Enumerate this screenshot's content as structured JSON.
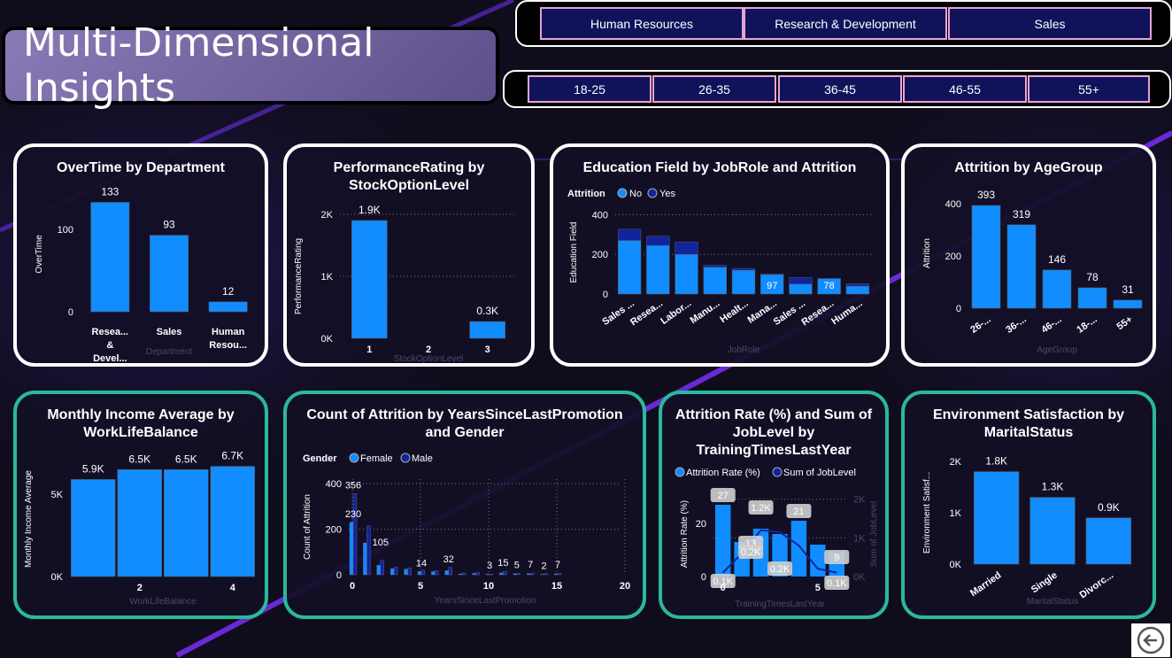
{
  "page": {
    "title": "Multi-Dimensional Insights"
  },
  "colors": {
    "bar": "#118dff",
    "dark_bar": "#12239e",
    "accent": "#2ab99a"
  },
  "slicers": {
    "department": [
      "Human Resources",
      "Research & Development",
      "Sales"
    ],
    "age_group": [
      "18-25",
      "26-35",
      "36-45",
      "46-55",
      "55+"
    ]
  },
  "icons": {
    "back": "back-arrow-icon"
  },
  "charts": {
    "overtime": {
      "title": "OverTime by Department"
    },
    "performance": {
      "title": "PerformanceRating by StockOptionLevel"
    },
    "education": {
      "title": "Education Field by JobRole and Attrition"
    },
    "agegroup": {
      "title": "Attrition by AgeGroup"
    },
    "income": {
      "title": "Monthly Income Average by WorkLifeBalance"
    },
    "promotion": {
      "title": "Count of Attrition by YearsSinceLastPromotion and Gender"
    },
    "training": {
      "title": "Attrition Rate (%) and Sum of JobLevel by TrainingTimesLastYear"
    },
    "environment": {
      "title": "Environment Satisfaction by MaritalStatus"
    }
  },
  "chart_data": [
    {
      "id": "overtime",
      "type": "bar",
      "title": "OverTime by Department",
      "ylabel": "OverTime",
      "xlabel": "Department",
      "categories": [
        "Resea... & Devel...",
        "Sales",
        "Human Resou..."
      ],
      "values": [
        133,
        93,
        12
      ],
      "data_labels": [
        "133",
        "93",
        "12"
      ],
      "yticks": [
        "0",
        "100"
      ],
      "ylim": [
        0,
        140
      ]
    },
    {
      "id": "performance",
      "type": "bar",
      "title": "PerformanceRating by StockOptionLevel",
      "ylabel": "PerformanceRating",
      "xlabel": "StockOptionLevel",
      "categories": [
        "1",
        "2",
        "3"
      ],
      "values": [
        1900,
        0,
        270
      ],
      "data_labels": [
        "1.9K",
        "",
        "0.3K"
      ],
      "yticks": [
        "0K",
        "1K",
        "2K"
      ],
      "ylim": [
        0,
        2000
      ]
    },
    {
      "id": "education",
      "type": "bar",
      "title": "Education Field by JobRole and Attrition",
      "ylabel": "Education Field",
      "xlabel": "JobRole",
      "legend_title": "Attrition",
      "categories": [
        "Sales ...",
        "Resea...",
        "Labor...",
        "Manu...",
        "Healt...",
        "Mana...",
        "Sales ...",
        "Resea...",
        "Huma..."
      ],
      "series": [
        {
          "name": "No",
          "values": [
            270,
            245,
            200,
            135,
            120,
            97,
            50,
            78,
            40
          ]
        },
        {
          "name": "Yes",
          "values": [
            57,
            47,
            62,
            10,
            9,
            5,
            33,
            0,
            12
          ]
        }
      ],
      "data_labels": {
        "5": "97",
        "7": "78"
      },
      "yticks": [
        "0",
        "200",
        "400"
      ],
      "ylim": [
        0,
        420
      ]
    },
    {
      "id": "agegroup",
      "type": "bar",
      "title": "Attrition by AgeGroup",
      "ylabel": "Attrition",
      "xlabel": "AgeGroup",
      "categories": [
        "26-...",
        "36-...",
        "46-...",
        "18-...",
        "55+"
      ],
      "values": [
        393,
        319,
        146,
        78,
        31
      ],
      "data_labels": [
        "393",
        "319",
        "146",
        "78",
        "31"
      ],
      "yticks": [
        "0",
        "200",
        "400"
      ],
      "ylim": [
        0,
        420
      ]
    },
    {
      "id": "income",
      "type": "bar",
      "title": "Monthly Income Average by WorkLifeBalance",
      "ylabel": "Monthly Income Average",
      "xlabel": "WorkLifeBalance",
      "categories": [
        "1",
        "2",
        "3",
        "4"
      ],
      "tick_labels": [
        "",
        "2",
        "",
        "4"
      ],
      "values": [
        5900,
        6500,
        6500,
        6700
      ],
      "data_labels": [
        "5.9K",
        "6.5K",
        "6.5K",
        "6.7K"
      ],
      "yticks": [
        "0K",
        "5K"
      ],
      "ylim": [
        0,
        7000
      ]
    },
    {
      "id": "promotion",
      "type": "bar",
      "title": "Count of Attrition by YearsSinceLastPromotion and Gender",
      "ylabel": "Count of Attrition",
      "xlabel": "YearsSinceLastPromotion",
      "legend_title": "Gender",
      "x": [
        0,
        1,
        2,
        3,
        4,
        5,
        6,
        7,
        8,
        9,
        10,
        11,
        12,
        13,
        14,
        15
      ],
      "series": [
        {
          "name": "Female",
          "values": [
            230,
            140,
            42,
            27,
            25,
            15,
            14,
            18,
            4,
            6,
            3,
            8,
            5,
            5,
            2,
            4
          ]
        },
        {
          "name": "Male",
          "values": [
            356,
            215,
            63,
            33,
            30,
            20,
            18,
            32,
            8,
            10,
            3,
            15,
            7,
            7,
            5,
            7
          ]
        }
      ],
      "data_labels": [
        "356",
        "230",
        "105",
        "14",
        "32",
        "3",
        "15",
        "5",
        "7",
        "2",
        "7"
      ],
      "xticks": [
        "0",
        "5",
        "10",
        "15",
        "20"
      ],
      "yticks": [
        "0",
        "200",
        "400"
      ],
      "ylim": [
        0,
        420
      ]
    },
    {
      "id": "training",
      "type": "bar",
      "title": "Attrition Rate (%) and Sum of JobLevel by TrainingTimesLastYear",
      "ylabel": "Attrition Rate (%)",
      "y2label": "Sum of JobLevel",
      "xlabel": "TrainingTimesLastYear",
      "x": [
        0,
        1,
        2,
        3,
        4,
        5,
        6
      ],
      "series": [
        {
          "name": "Attrition Rate (%)",
          "values": [
            27,
            13,
            18,
            16,
            21,
            12,
            9
          ]
        },
        {
          "name": "Sum of JobLevel",
          "values": [
            100,
            600,
            1200,
            1150,
            800,
            200,
            100
          ]
        }
      ],
      "data_labels": [
        "27",
        "1.2K",
        "21",
        "13",
        "9",
        "0.2K",
        "0.2K",
        "0.1K",
        "0.1K"
      ],
      "xticks": [
        "0",
        "5"
      ],
      "yticks": [
        "0",
        "20"
      ],
      "y2ticks": [
        "0K",
        "1K",
        "2K"
      ],
      "ylim": [
        0,
        32
      ],
      "y2lim": [
        0,
        2200
      ]
    },
    {
      "id": "environment",
      "type": "bar",
      "title": "Environment Satisfaction by MaritalStatus",
      "ylabel": "Environment Satisf...",
      "xlabel": "MaritalStatus",
      "categories": [
        "Married",
        "Single",
        "Divorc..."
      ],
      "values": [
        1800,
        1300,
        900
      ],
      "data_labels": [
        "1.8K",
        "1.3K",
        "0.9K"
      ],
      "yticks": [
        "0K",
        "1K",
        "2K"
      ],
      "ylim": [
        0,
        2000
      ]
    }
  ]
}
